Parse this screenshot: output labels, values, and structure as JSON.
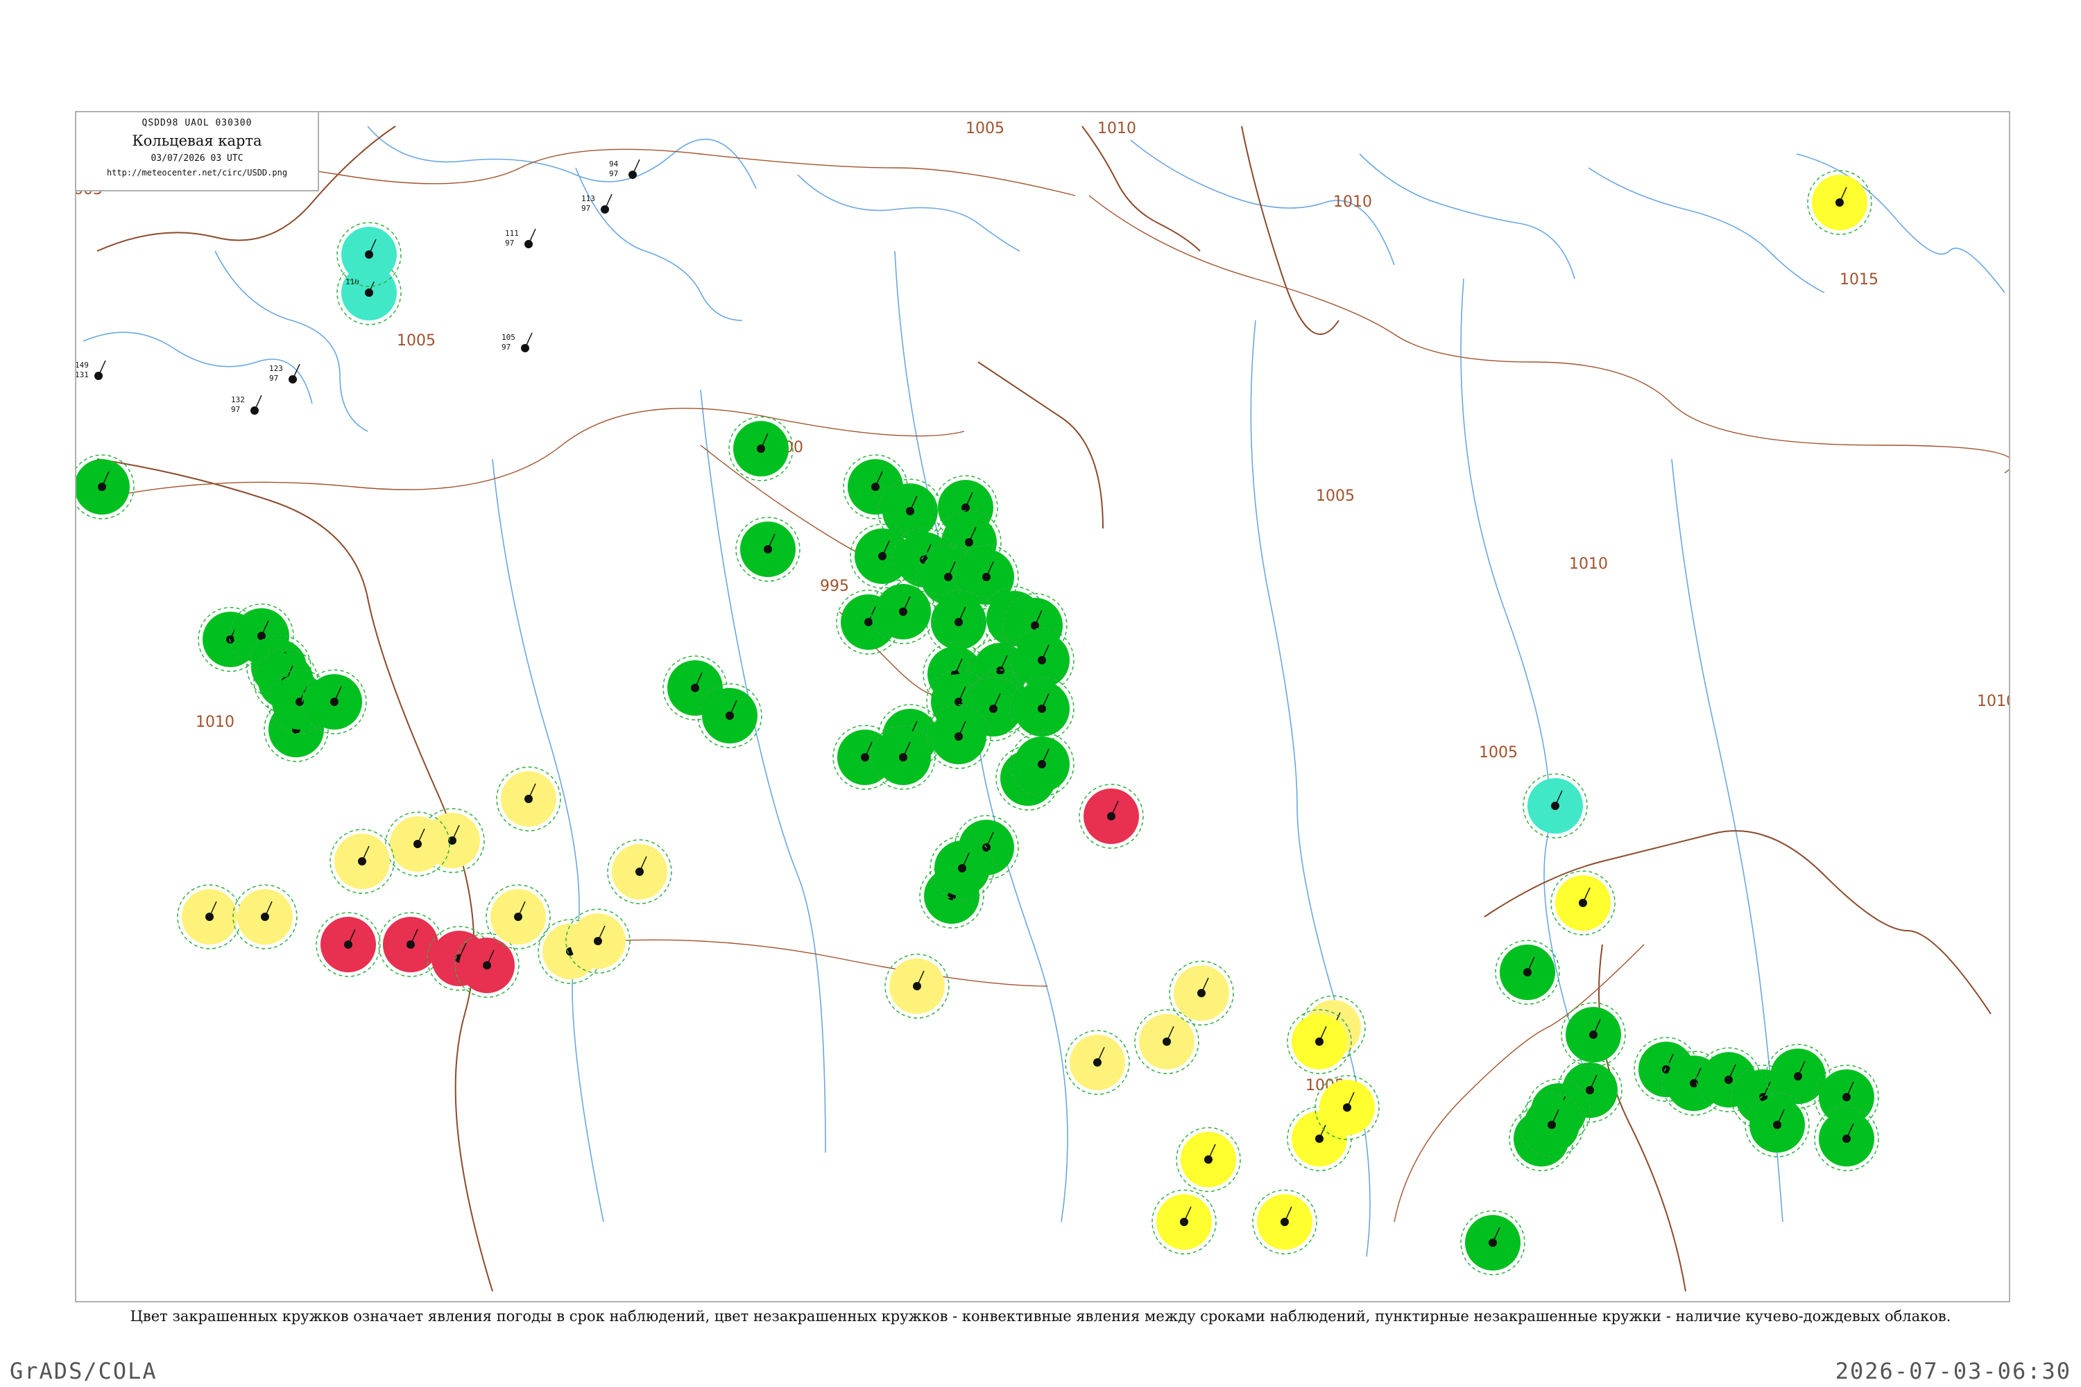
{
  "header": {
    "codes": "QSDD98  UAOL  030300",
    "title": "Кольцевая карта",
    "datetime": "03/07/2026 03 UTC",
    "url": "http://meteocenter.net/circ/USDD.png"
  },
  "caption": "Цвет закрашенных кружков означает явления погоды в срок наблюдений, цвет незакрашенных кружков - конвективные явления между сроками наблюдений, пунктирные незакрашенные кружки - наличие кучево-дождевых облаков.",
  "footer": {
    "software": "GrADS/COLA",
    "timestamp": "2026-07-03-06:30"
  },
  "colors": {
    "frame": "#b0b0b0",
    "coast": "#6aa7e0",
    "border": "#8b4a2b",
    "isobar": "#a0522d",
    "rain": "#00c020",
    "shower": "#10d060",
    "thunder": "#e83050",
    "fog": "#fff27a",
    "haze": "#ffff30",
    "snow": "#40e8c8",
    "dashed": "#30b040"
  },
  "isobars": [
    {
      "label": "1005"
    },
    {
      "label": "1005"
    },
    {
      "label": "1005"
    },
    {
      "label": "1005"
    },
    {
      "label": "1005"
    },
    {
      "label": "1005"
    },
    {
      "label": "1010"
    },
    {
      "label": "1010"
    },
    {
      "label": "1010"
    },
    {
      "label": "1010"
    },
    {
      "label": "1010"
    },
    {
      "label": "1015"
    },
    {
      "label": "1000"
    },
    {
      "label": "995"
    }
  ],
  "stations": [
    {
      "top": "94",
      "mid": "97",
      "bot": "",
      "fill": "none"
    },
    {
      "top": "113",
      "mid": "97",
      "bot": "",
      "fill": "none"
    },
    {
      "top": "105",
      "mid": "97",
      "bot": "",
      "fill": "none"
    },
    {
      "top": "111",
      "mid": "97",
      "bot": "",
      "fill": "none"
    },
    {
      "top": "149",
      "mid": "131",
      "bot": "",
      "fill": "none"
    },
    {
      "top": "123",
      "mid": "97",
      "bot": "",
      "fill": "none"
    },
    {
      "top": "132",
      "mid": "97",
      "bot": "",
      "fill": "none"
    },
    {
      "top": "110",
      "mid": "",
      "bot": "",
      "fill": "snow"
    },
    {
      "top": "",
      "mid": "",
      "bot": "",
      "fill": "snow"
    },
    {
      "top": "",
      "mid": "",
      "bot": "",
      "fill": "rain"
    },
    {
      "top": "",
      "mid": "",
      "bot": "",
      "fill": "rain"
    },
    {
      "top": "",
      "mid": "",
      "bot": "",
      "fill": "rain"
    },
    {
      "top": "",
      "mid": "",
      "bot": "",
      "fill": "rain"
    },
    {
      "top": "",
      "mid": "",
      "bot": "",
      "fill": "rain"
    },
    {
      "top": "",
      "mid": "",
      "bot": "",
      "fill": "rain"
    },
    {
      "top": "",
      "mid": "",
      "bot": "",
      "fill": "rain"
    },
    {
      "top": "",
      "mid": "",
      "bot": "",
      "fill": "rain"
    },
    {
      "top": "",
      "mid": "",
      "bot": "",
      "fill": "rain"
    },
    {
      "top": "",
      "mid": "",
      "bot": "",
      "fill": "rain"
    },
    {
      "top": "",
      "mid": "",
      "bot": "",
      "fill": "rain"
    },
    {
      "top": "",
      "mid": "",
      "bot": "",
      "fill": "rain"
    },
    {
      "top": "",
      "mid": "",
      "bot": "",
      "fill": "rain"
    },
    {
      "top": "",
      "mid": "",
      "bot": "",
      "fill": "rain"
    },
    {
      "top": "",
      "mid": "",
      "bot": "",
      "fill": "rain"
    },
    {
      "top": "",
      "mid": "",
      "bot": "",
      "fill": "rain"
    },
    {
      "top": "",
      "mid": "",
      "bot": "",
      "fill": "rain"
    },
    {
      "top": "",
      "mid": "",
      "bot": "",
      "fill": "rain"
    },
    {
      "top": "",
      "mid": "",
      "bot": "",
      "fill": "rain"
    },
    {
      "top": "",
      "mid": "",
      "bot": "",
      "fill": "rain"
    },
    {
      "top": "",
      "mid": "",
      "bot": "",
      "fill": "rain"
    },
    {
      "top": "",
      "mid": "",
      "bot": "",
      "fill": "rain"
    },
    {
      "top": "",
      "mid": "",
      "bot": "",
      "fill": "rain"
    },
    {
      "top": "",
      "mid": "",
      "bot": "",
      "fill": "rain"
    },
    {
      "top": "",
      "mid": "",
      "bot": "",
      "fill": "rain"
    },
    {
      "top": "",
      "mid": "",
      "bot": "",
      "fill": "rain"
    },
    {
      "top": "",
      "mid": "",
      "bot": "",
      "fill": "rain"
    },
    {
      "top": "",
      "mid": "",
      "bot": "",
      "fill": "rain"
    },
    {
      "top": "",
      "mid": "",
      "bot": "",
      "fill": "rain"
    },
    {
      "top": "",
      "mid": "",
      "bot": "",
      "fill": "rain"
    },
    {
      "top": "",
      "mid": "",
      "bot": "",
      "fill": "rain"
    },
    {
      "top": "",
      "mid": "",
      "bot": "",
      "fill": "rain"
    },
    {
      "top": "",
      "mid": "",
      "bot": "",
      "fill": "rain"
    },
    {
      "top": "",
      "mid": "",
      "bot": "",
      "fill": "rain"
    },
    {
      "top": "",
      "mid": "",
      "bot": "",
      "fill": "rain"
    },
    {
      "top": "",
      "mid": "",
      "bot": "",
      "fill": "rain"
    },
    {
      "top": "",
      "mid": "",
      "bot": "",
      "fill": "rain"
    },
    {
      "top": "",
      "mid": "",
      "bot": "",
      "fill": "rain"
    },
    {
      "top": "",
      "mid": "",
      "bot": "",
      "fill": "rain"
    },
    {
      "top": "",
      "mid": "",
      "bot": "",
      "fill": "rain"
    },
    {
      "top": "",
      "mid": "",
      "bot": "",
      "fill": "rain"
    },
    {
      "top": "",
      "mid": "",
      "bot": "",
      "fill": "thunder"
    },
    {
      "top": "",
      "mid": "",
      "bot": "",
      "fill": "thunder"
    },
    {
      "top": "",
      "mid": "",
      "bot": "",
      "fill": "thunder"
    },
    {
      "top": "",
      "mid": "",
      "bot": "",
      "fill": "thunder"
    },
    {
      "top": "",
      "mid": "",
      "bot": "",
      "fill": "thunder"
    },
    {
      "top": "",
      "mid": "",
      "bot": "",
      "fill": "fog"
    },
    {
      "top": "",
      "mid": "",
      "bot": "",
      "fill": "fog"
    },
    {
      "top": "",
      "mid": "",
      "bot": "",
      "fill": "fog"
    },
    {
      "top": "",
      "mid": "",
      "bot": "",
      "fill": "fog"
    },
    {
      "top": "",
      "mid": "",
      "bot": "",
      "fill": "fog"
    },
    {
      "top": "",
      "mid": "",
      "bot": "",
      "fill": "fog"
    },
    {
      "top": "",
      "mid": "",
      "bot": "",
      "fill": "fog"
    },
    {
      "top": "",
      "mid": "",
      "bot": "",
      "fill": "fog"
    },
    {
      "top": "",
      "mid": "",
      "bot": "",
      "fill": "fog"
    },
    {
      "top": "",
      "mid": "",
      "bot": "",
      "fill": "fog"
    },
    {
      "top": "",
      "mid": "",
      "bot": "",
      "fill": "fog"
    },
    {
      "top": "",
      "mid": "",
      "bot": "",
      "fill": "fog"
    },
    {
      "top": "",
      "mid": "",
      "bot": "",
      "fill": "fog"
    },
    {
      "top": "",
      "mid": "",
      "bot": "",
      "fill": "haze"
    },
    {
      "top": "",
      "mid": "",
      "bot": "",
      "fill": "haze"
    },
    {
      "top": "",
      "mid": "",
      "bot": "",
      "fill": "haze"
    },
    {
      "top": "",
      "mid": "",
      "bot": "",
      "fill": "haze"
    },
    {
      "top": "",
      "mid": "",
      "bot": "",
      "fill": "haze"
    },
    {
      "top": "",
      "mid": "",
      "bot": "",
      "fill": "haze"
    },
    {
      "top": "",
      "mid": "",
      "bot": "",
      "fill": "snow"
    },
    {
      "top": "",
      "mid": "",
      "bot": "",
      "fill": "snow"
    },
    {
      "top": "",
      "mid": "",
      "bot": "",
      "fill": "rain"
    },
    {
      "top": "",
      "mid": "",
      "bot": "",
      "fill": "rain"
    },
    {
      "top": "",
      "mid": "",
      "bot": "",
      "fill": "rain"
    },
    {
      "top": "",
      "mid": "",
      "bot": "",
      "fill": "rain"
    },
    {
      "top": "",
      "mid": "",
      "bot": "",
      "fill": "rain"
    },
    {
      "top": "",
      "mid": "",
      "bot": "",
      "fill": "rain"
    },
    {
      "top": "",
      "mid": "",
      "bot": "",
      "fill": "rain"
    },
    {
      "top": "",
      "mid": "",
      "bot": "",
      "fill": "rain"
    },
    {
      "top": "",
      "mid": "",
      "bot": "",
      "fill": "rain"
    },
    {
      "top": "",
      "mid": "",
      "bot": "",
      "fill": "rain"
    },
    {
      "top": "",
      "mid": "",
      "bot": "",
      "fill": "rain"
    },
    {
      "top": "",
      "mid": "",
      "bot": "",
      "fill": "rain"
    },
    {
      "top": "",
      "mid": "",
      "bot": "",
      "fill": "rain"
    },
    {
      "top": "",
      "mid": "",
      "bot": "",
      "fill": "rain"
    },
    {
      "top": "",
      "mid": "",
      "bot": "",
      "fill": "rain"
    },
    {
      "top": "",
      "mid": "",
      "bot": "",
      "fill": "haze"
    },
    {
      "top": "",
      "mid": "",
      "bot": "",
      "fill": "haze"
    },
    {
      "top": "",
      "mid": "",
      "bot": "",
      "fill": "fog"
    },
    {
      "top": "",
      "mid": "",
      "bot": "",
      "fill": "fog"
    },
    {
      "top": "",
      "mid": "",
      "bot": "",
      "fill": "thunder"
    }
  ]
}
